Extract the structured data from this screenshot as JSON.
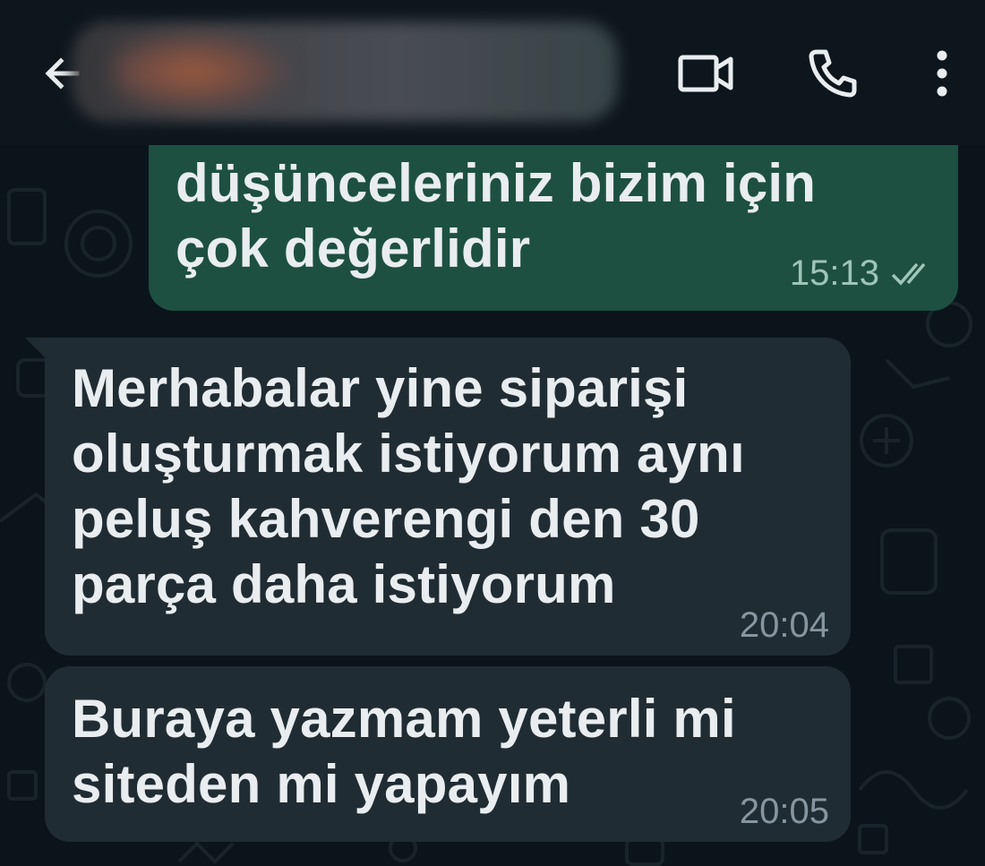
{
  "header": {
    "contact_name": "",
    "icons": {
      "back": "back-arrow-icon",
      "video": "video-call-icon",
      "call": "phone-icon",
      "menu": "more-vert-icon"
    }
  },
  "messages": [
    {
      "direction": "outgoing",
      "text": "düşünceleriniz bizim için\nçok değerlidir",
      "time": "15:13",
      "status": "read-ticks-icon"
    },
    {
      "direction": "incoming",
      "text": "Merhabalar yine siparişi\noluşturmak istiyorum aynı\npeluş kahverengi den 30\nparça daha istiyorum",
      "time": "20:04"
    },
    {
      "direction": "incoming",
      "text": "Buraya yazmam yeterli mi\nsiteden mi yapayım",
      "time": "20:05"
    }
  ],
  "colors": {
    "background": "#0b141a",
    "outgoing_bubble": "#1d5040",
    "incoming_bubble": "#202c33",
    "text": "#e9edef",
    "meta": "#8696a0"
  }
}
